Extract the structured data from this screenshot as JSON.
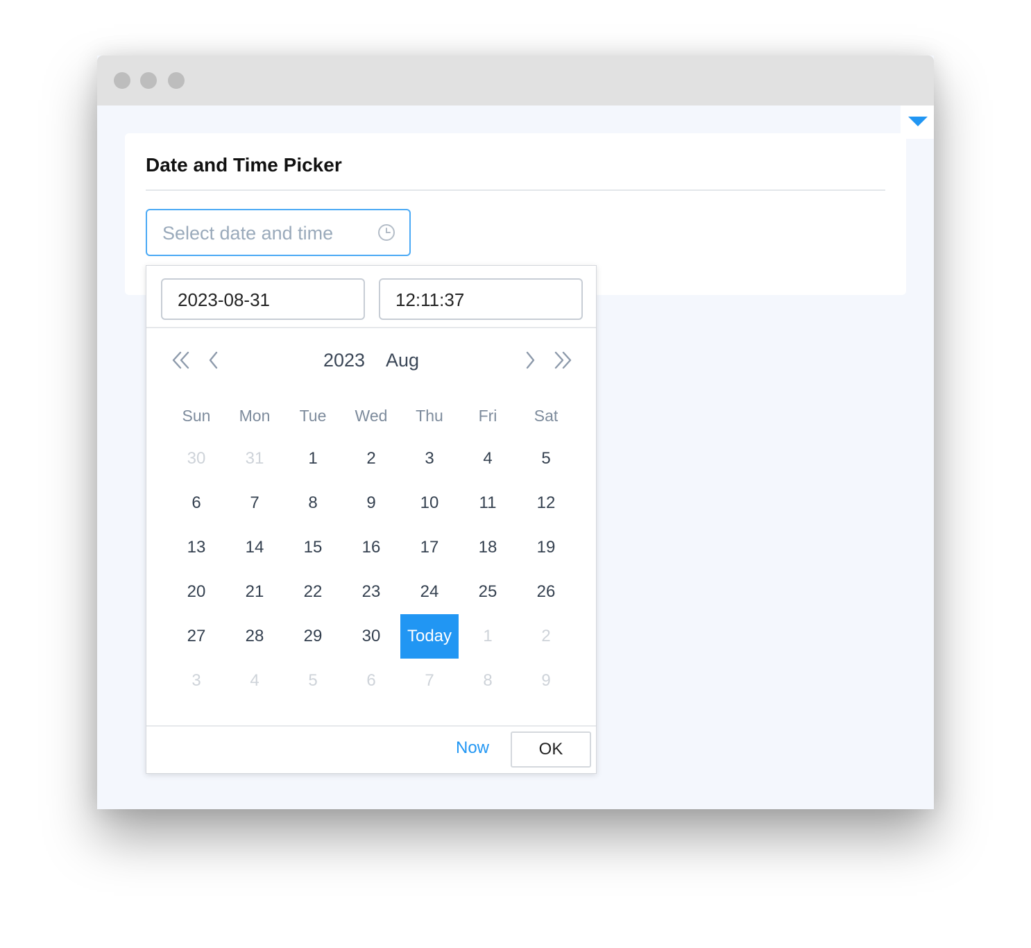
{
  "card": {
    "title": "Date and Time Picker",
    "input_placeholder": "Select date and time",
    "input_value": ""
  },
  "popup": {
    "date_value": "2023-08-31",
    "time_value": "12:11:37",
    "year": "2023",
    "month": "Aug",
    "weekdays": [
      "Sun",
      "Mon",
      "Tue",
      "Wed",
      "Thu",
      "Fri",
      "Sat"
    ],
    "days": [
      {
        "label": "30",
        "muted": true
      },
      {
        "label": "31",
        "muted": true
      },
      {
        "label": "1"
      },
      {
        "label": "2"
      },
      {
        "label": "3"
      },
      {
        "label": "4"
      },
      {
        "label": "5"
      },
      {
        "label": "6"
      },
      {
        "label": "7"
      },
      {
        "label": "8"
      },
      {
        "label": "9"
      },
      {
        "label": "10"
      },
      {
        "label": "11"
      },
      {
        "label": "12"
      },
      {
        "label": "13"
      },
      {
        "label": "14"
      },
      {
        "label": "15"
      },
      {
        "label": "16"
      },
      {
        "label": "17"
      },
      {
        "label": "18"
      },
      {
        "label": "19"
      },
      {
        "label": "20"
      },
      {
        "label": "21"
      },
      {
        "label": "22"
      },
      {
        "label": "23"
      },
      {
        "label": "24"
      },
      {
        "label": "25"
      },
      {
        "label": "26"
      },
      {
        "label": "27"
      },
      {
        "label": "28"
      },
      {
        "label": "29"
      },
      {
        "label": "30"
      },
      {
        "label": "Today",
        "today": true
      },
      {
        "label": "1",
        "muted": true
      },
      {
        "label": "2",
        "muted": true
      },
      {
        "label": "3",
        "muted": true
      },
      {
        "label": "4",
        "muted": true
      },
      {
        "label": "5",
        "muted": true
      },
      {
        "label": "6",
        "muted": true
      },
      {
        "label": "7",
        "muted": true
      },
      {
        "label": "8",
        "muted": true
      },
      {
        "label": "9",
        "muted": true
      }
    ],
    "now_label": "Now",
    "ok_label": "OK"
  },
  "colors": {
    "accent": "#2196f3",
    "muted_day": "#ced3d9",
    "text": "#34404f"
  },
  "icons": {
    "input": "clock-icon",
    "nav": [
      "double-chevron-left-icon",
      "chevron-left-icon",
      "chevron-right-icon",
      "double-chevron-right-icon"
    ],
    "corner": "caret-down-icon"
  }
}
